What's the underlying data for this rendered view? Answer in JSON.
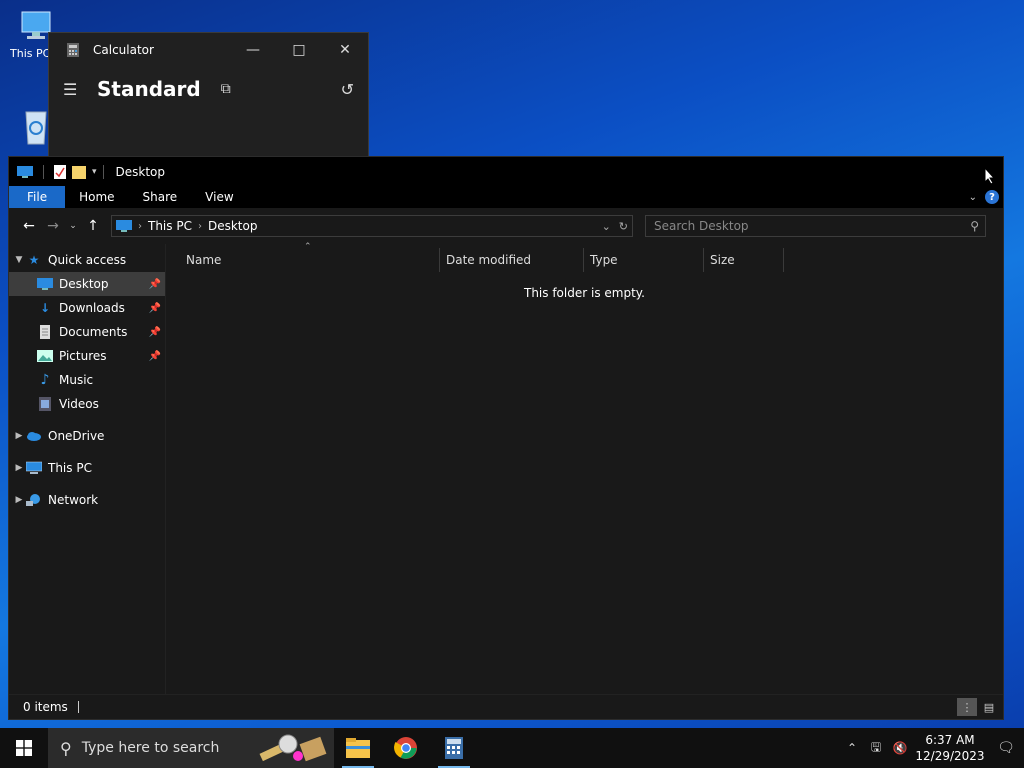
{
  "desktop": {
    "icons": [
      {
        "label": "This PC"
      },
      {
        "label": "Recycle Bin"
      }
    ]
  },
  "calculator": {
    "title": "Calculator",
    "mode": "Standard"
  },
  "explorer": {
    "title": "Desktop",
    "ribbon_tabs": [
      "File",
      "Home",
      "Share",
      "View"
    ],
    "breadcrumb": [
      "This PC",
      "Desktop"
    ],
    "search_placeholder": "Search Desktop",
    "nav": {
      "quick_access": "Quick access",
      "quick_items": [
        "Desktop",
        "Downloads",
        "Documents",
        "Pictures",
        "Music",
        "Videos"
      ],
      "onedrive": "OneDrive",
      "this_pc": "This PC",
      "network": "Network"
    },
    "columns": [
      "Name",
      "Date modified",
      "Type",
      "Size"
    ],
    "empty_message": "This folder is empty.",
    "status": "0 items"
  },
  "taskbar": {
    "search_placeholder": "Type here to search",
    "time": "6:37 AM",
    "date": "12/29/2023"
  },
  "colors": {
    "accent": "#1a69c8",
    "window_bg": "#191919",
    "selected": "#3d3d3d"
  }
}
